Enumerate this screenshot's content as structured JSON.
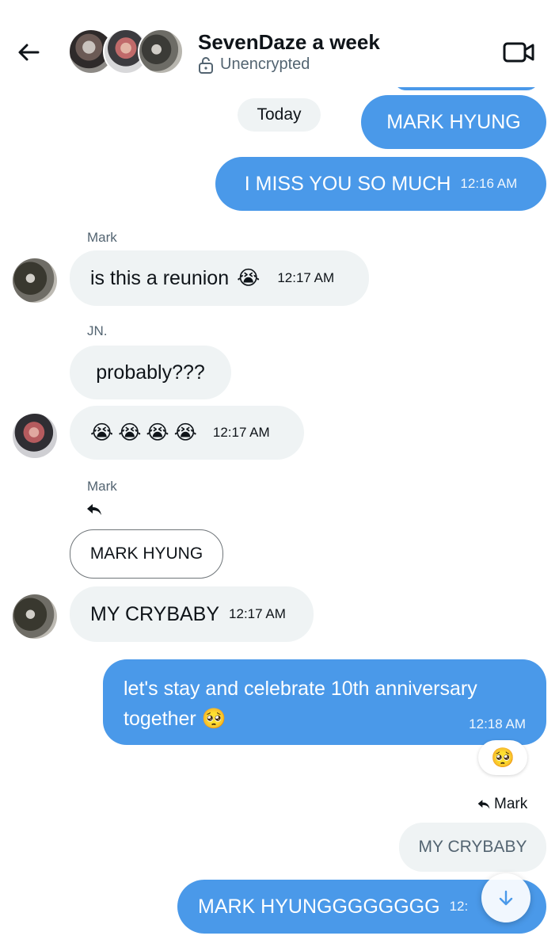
{
  "header": {
    "title": "SevenDaze a week",
    "subtitle": "Unencrypted"
  },
  "date_separator": "Today",
  "messages": {
    "m1": {
      "text": "MARK HYUNG"
    },
    "m2": {
      "text": "I MISS YOU SO MUCH",
      "time": "12:16 AM"
    },
    "m3": {
      "sender": "Mark",
      "text": "is this a reunion",
      "emoji": "😭",
      "time": "12:17 AM"
    },
    "m4": {
      "sender": "JN.",
      "text": "probably???"
    },
    "m5": {
      "emoji": "😭😭😭😭",
      "time": "12:17 AM"
    },
    "m6": {
      "sender": "Mark",
      "quoted": "MARK HYUNG",
      "text": "MY CRYBABY",
      "time": "12:17 AM"
    },
    "m7": {
      "line1": "let's stay and celebrate 10th anniversary",
      "line2": "together",
      "emoji": "🥺",
      "time": "12:18 AM",
      "reaction": "🥺"
    },
    "m8": {
      "reply_to": "Mark",
      "quoted": "MY CRYBABY",
      "text": "MARK HYUNGGGGGGGG",
      "time_partial": "12:"
    }
  }
}
